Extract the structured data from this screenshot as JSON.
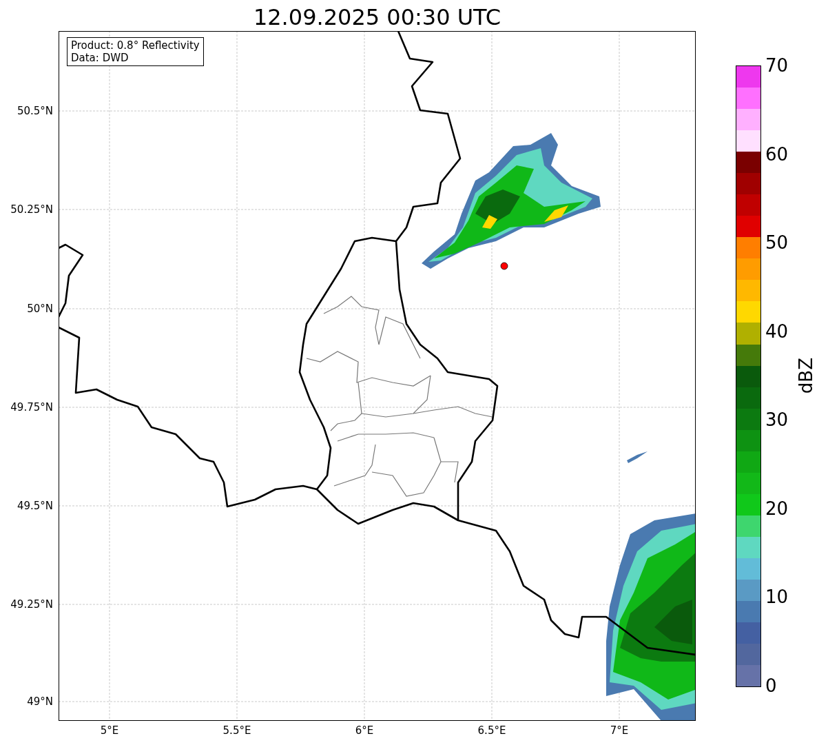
{
  "title": "12.09.2025 00:30 UTC",
  "legend": [
    "Product: 0.8° Reflectivity",
    "Data: DWD"
  ],
  "lat_labels": [
    "50.5°N",
    "50.25°N",
    "50°N",
    "49.75°N",
    "49.5°N",
    "49.25°N",
    "49°N"
  ],
  "lon_labels": [
    "5°E",
    "5.5°E",
    "6°E",
    "6.5°E",
    "7°E"
  ],
  "colorbar": {
    "label": "dBZ",
    "ticks": [
      "70",
      "60",
      "50",
      "40",
      "30",
      "20",
      "10",
      "0"
    ],
    "bands": [
      {
        "color": "#6672a8"
      },
      {
        "color": "#52679e"
      },
      {
        "color": "#4460a2"
      },
      {
        "color": "#4a7ab0"
      },
      {
        "color": "#5a9ac4"
      },
      {
        "color": "#62bcd8"
      },
      {
        "color": "#5fd8c0"
      },
      {
        "color": "#3ed66e"
      },
      {
        "color": "#10c81a"
      },
      {
        "color": "#12b818"
      },
      {
        "color": "#10a814"
      },
      {
        "color": "#0e9212"
      },
      {
        "color": "#0c7a10"
      },
      {
        "color": "#0a6a0e"
      },
      {
        "color": "#0a5a0c"
      },
      {
        "color": "#457a0a"
      },
      {
        "color": "#b0b000"
      },
      {
        "color": "#ffd800"
      },
      {
        "color": "#ffb800"
      },
      {
        "color": "#ff9c00"
      },
      {
        "color": "#ff7e00"
      },
      {
        "color": "#e00000"
      },
      {
        "color": "#c00000"
      },
      {
        "color": "#a00000"
      },
      {
        "color": "#7a0000"
      },
      {
        "color": "#ffe0ff"
      },
      {
        "color": "#ffb0ff"
      },
      {
        "color": "#ff70ff"
      },
      {
        "color": "#ee38ee"
      }
    ]
  }
}
